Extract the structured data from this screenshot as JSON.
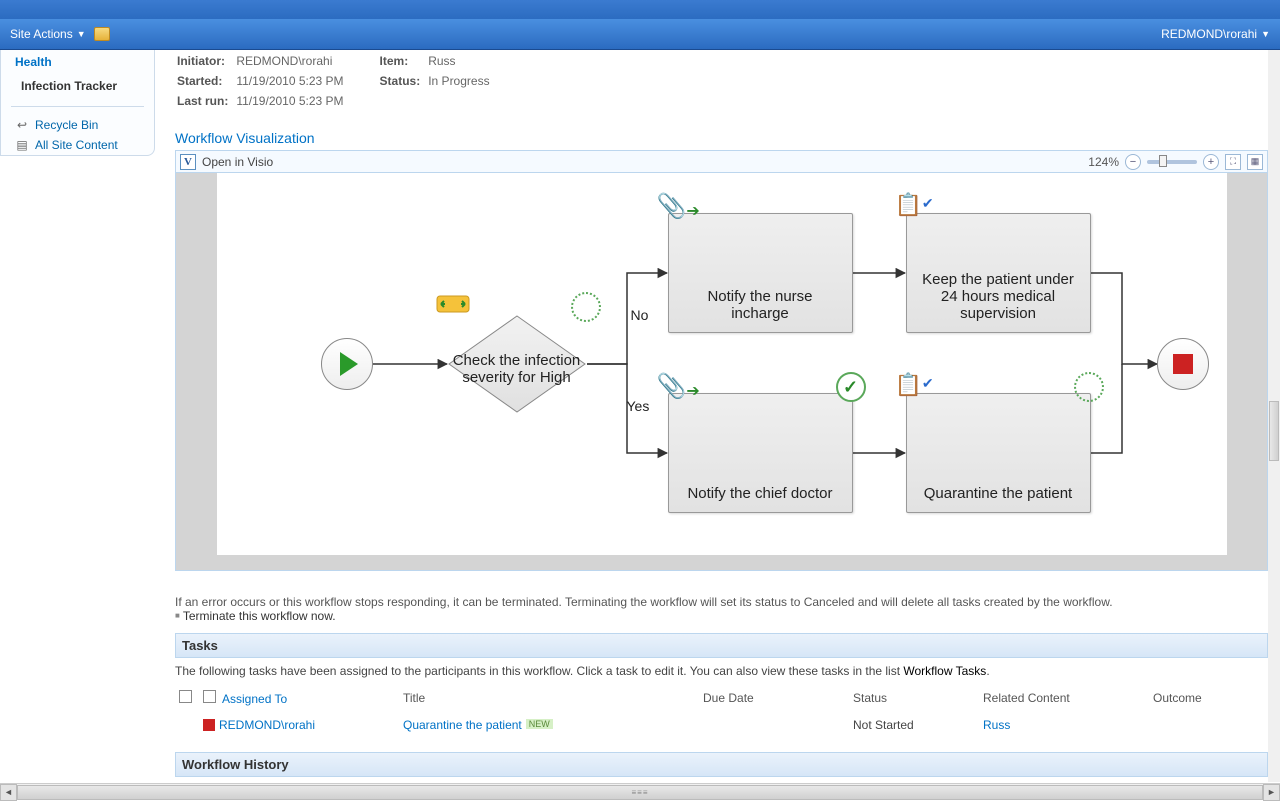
{
  "ribbon": {
    "site_actions": "Site Actions",
    "user": "REDMOND\\rorahi"
  },
  "sidebar": {
    "health": "Health",
    "infection_tracker": "Infection Tracker",
    "recycle": "Recycle Bin",
    "all_content": "All Site Content"
  },
  "meta": {
    "initiator_label": "Initiator:",
    "initiator": "REDMOND\\rorahi",
    "item_label": "Item:",
    "item": "Russ",
    "started_label": "Started:",
    "started": "11/19/2010 5:23 PM",
    "status_label": "Status:",
    "status": "In Progress",
    "lastrun_label": "Last run:",
    "lastrun": "11/19/2010 5:23 PM"
  },
  "viz": {
    "title": "Workflow Visualization",
    "open_visio": "Open in Visio",
    "zoom": "124%",
    "decision": "Check the infection severity for High",
    "edge_no": "No",
    "edge_yes": "Yes",
    "task_nurse": "Notify the nurse incharge",
    "task_chief": "Notify the chief doctor",
    "task_keep": "Keep the patient under 24 hours medical supervision",
    "task_quarantine": "Quarantine the patient"
  },
  "error": {
    "text": "If an error occurs or this workflow stops responding, it can be terminated. Terminating the workflow will set its status to Canceled and will delete all tasks created by the workflow.",
    "terminate": "Terminate this workflow now."
  },
  "tasks": {
    "header": "Tasks",
    "note_a": "The following tasks have been assigned to the participants in this workflow. Click a task to edit it. You can also view these tasks in the list ",
    "note_link": "Workflow Tasks",
    "cols": {
      "assigned": "Assigned To",
      "title": "Title",
      "due": "Due Date",
      "status": "Status",
      "related": "Related Content",
      "outcome": "Outcome"
    },
    "row": {
      "assigned": "REDMOND\\rorahi",
      "title": "Quarantine the patient",
      "new": "NEW",
      "due": "",
      "status": "Not Started",
      "related": "Russ",
      "outcome": ""
    }
  },
  "history": {
    "header": "Workflow History"
  }
}
